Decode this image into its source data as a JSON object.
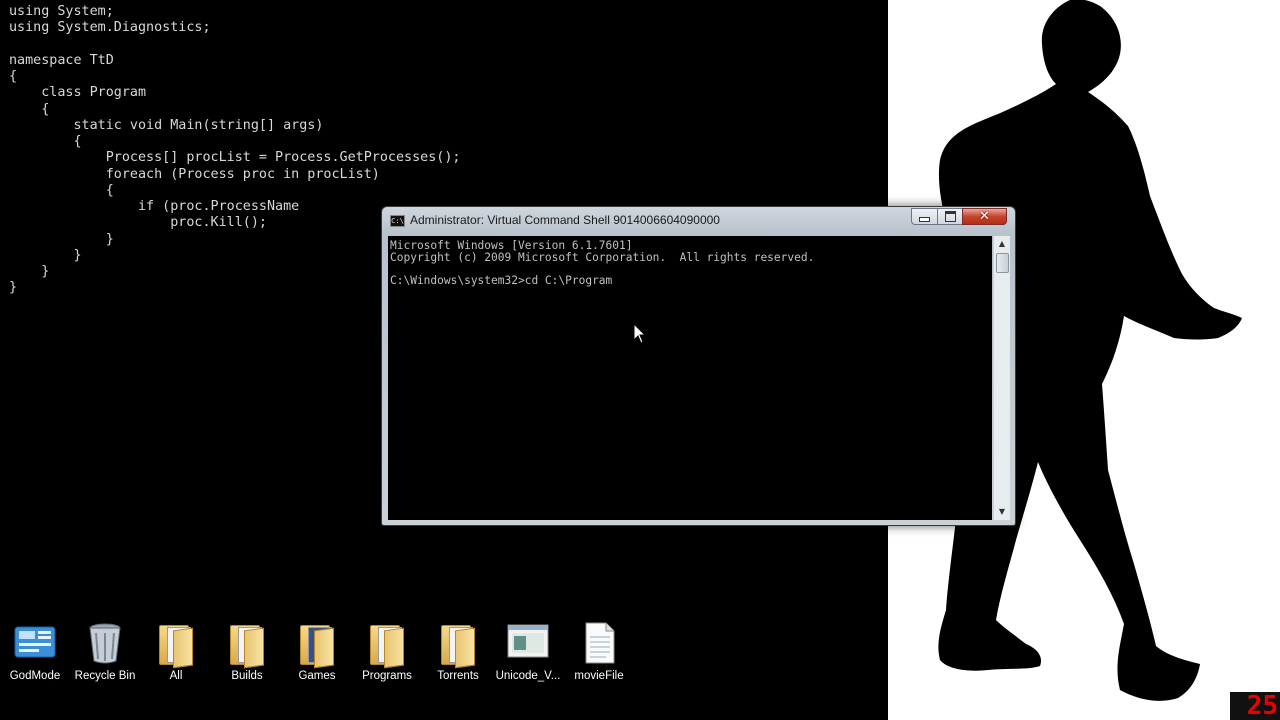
{
  "wallpaper": {
    "code_lines": [
      "using System;",
      "using System.Diagnostics;",
      "",
      "namespace TtD",
      "{",
      "    class Program",
      "    {",
      "        static void Main(string[] args)",
      "        {",
      "            Process[] procList = Process.GetProcesses();",
      "            foreach (Process proc in procList)",
      "            {",
      "                if (proc.ProcessName",
      "                    proc.Kill();",
      "            }",
      "        }",
      "    }",
      "}"
    ]
  },
  "window": {
    "title": "Administrator: Virtual Command Shell 9014006604090000",
    "close_glyph": "✕",
    "console_lines": [
      "Microsoft Windows [Version 6.1.7601]",
      "Copyright (c) 2009 Microsoft Corporation.  All rights reserved.",
      "",
      "C:\\Windows\\system32>cd C:\\Program"
    ]
  },
  "desktop_icons": [
    {
      "label": "GodMode",
      "icon": "control-panel-icon"
    },
    {
      "label": "Recycle Bin",
      "icon": "recycle-bin-icon"
    },
    {
      "label": "All",
      "icon": "folder-icon"
    },
    {
      "label": "Builds",
      "icon": "folder-icon"
    },
    {
      "label": "Games",
      "icon": "folder-icon"
    },
    {
      "label": "Programs",
      "icon": "folder-icon"
    },
    {
      "label": "Torrents",
      "icon": "folder-icon"
    },
    {
      "label": "Unicode_V...",
      "icon": "image-file-icon"
    },
    {
      "label": "movieFile",
      "icon": "text-file-icon"
    }
  ],
  "counter": "25",
  "colors": {
    "console_bg": "#000000",
    "console_text": "#c0c0c0",
    "close_button": "#c7442b",
    "counter_text": "#ee0000"
  }
}
